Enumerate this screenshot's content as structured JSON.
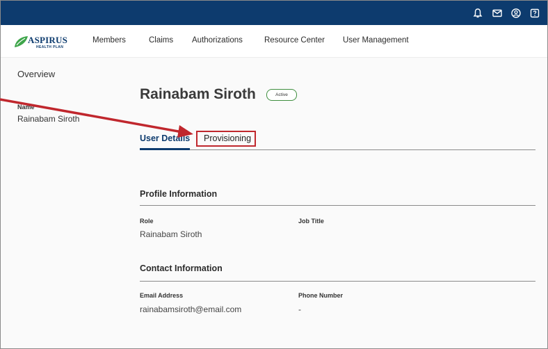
{
  "topbar": {
    "icons": [
      "bell-icon",
      "mail-icon",
      "user-circle-icon",
      "help-icon"
    ],
    "background": "#0d3b6e"
  },
  "brand": {
    "name": "ASPIRUS",
    "tagline": "HEALTH PLAN",
    "color": "#0d3b6e",
    "mark_color": "#3ea54a"
  },
  "nav": {
    "items": [
      "Members",
      "Claims",
      "Authorizations",
      "Resource Center",
      "User Management"
    ]
  },
  "sidebar": {
    "overview": "Overview",
    "name_label": "Name",
    "name_value": "Rainabam Siroth"
  },
  "user": {
    "name": "Rainabam Siroth",
    "status": "Active",
    "status_color": "#3e8e3e"
  },
  "tabs": {
    "items": [
      "User Details",
      "Provisioning"
    ],
    "active": "User Details"
  },
  "profile": {
    "heading": "Profile Information",
    "role_label": "Role",
    "role_value": "Rainabam Siroth",
    "job_title_label": "Job Title",
    "job_title_value": ""
  },
  "contact": {
    "heading": "Contact Information",
    "email_label": "Email Address",
    "email_value": "rainabamsiroth@email.com",
    "phone_label": "Phone Number",
    "phone_value": "-"
  },
  "annotation": {
    "highlight_color": "#c0272d",
    "target": "Provisioning"
  }
}
